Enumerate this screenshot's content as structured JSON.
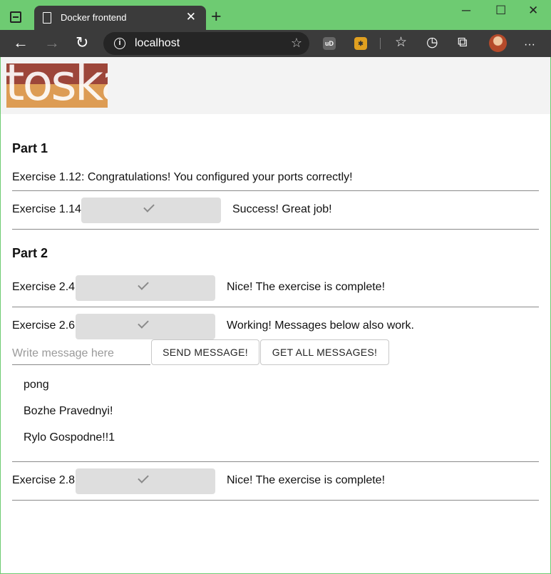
{
  "browser": {
    "tab_title": "Docker frontend",
    "url": "localhost",
    "minimize": "─",
    "maximize": "☐",
    "close": "✕",
    "new_tab": "+",
    "tab_close": "✕",
    "back": "←",
    "forward": "→",
    "refresh": "↻",
    "more": "···"
  },
  "logo": {
    "text": "toska",
    "top_color": "#9d463a",
    "bottom_color": "#dd9c54"
  },
  "part1": {
    "heading": "Part 1",
    "ex112": "Exercise 1.12: Congratulations! You configured your ports correctly!",
    "ex114_label": "Exercise 1.14:",
    "ex114_status": "Success! Great job!"
  },
  "part2": {
    "heading": "Part 2",
    "ex24_label": "Exercise 2.4:",
    "ex24_status": "Nice! The exercise is complete!",
    "ex26_label": "Exercise 2.6:",
    "ex26_status": "Working! Messages below also work.",
    "message_placeholder": "Write message here",
    "send_label": "SEND MESSAGE!",
    "get_all_label": "GET ALL MESSAGES!",
    "messages": [
      "pong",
      "Bozhe Pravednyi!",
      "Rylo Gospodne!!1"
    ],
    "ex28_label": "Exercise 2.8:",
    "ex28_status": "Nice! The exercise is complete!"
  }
}
